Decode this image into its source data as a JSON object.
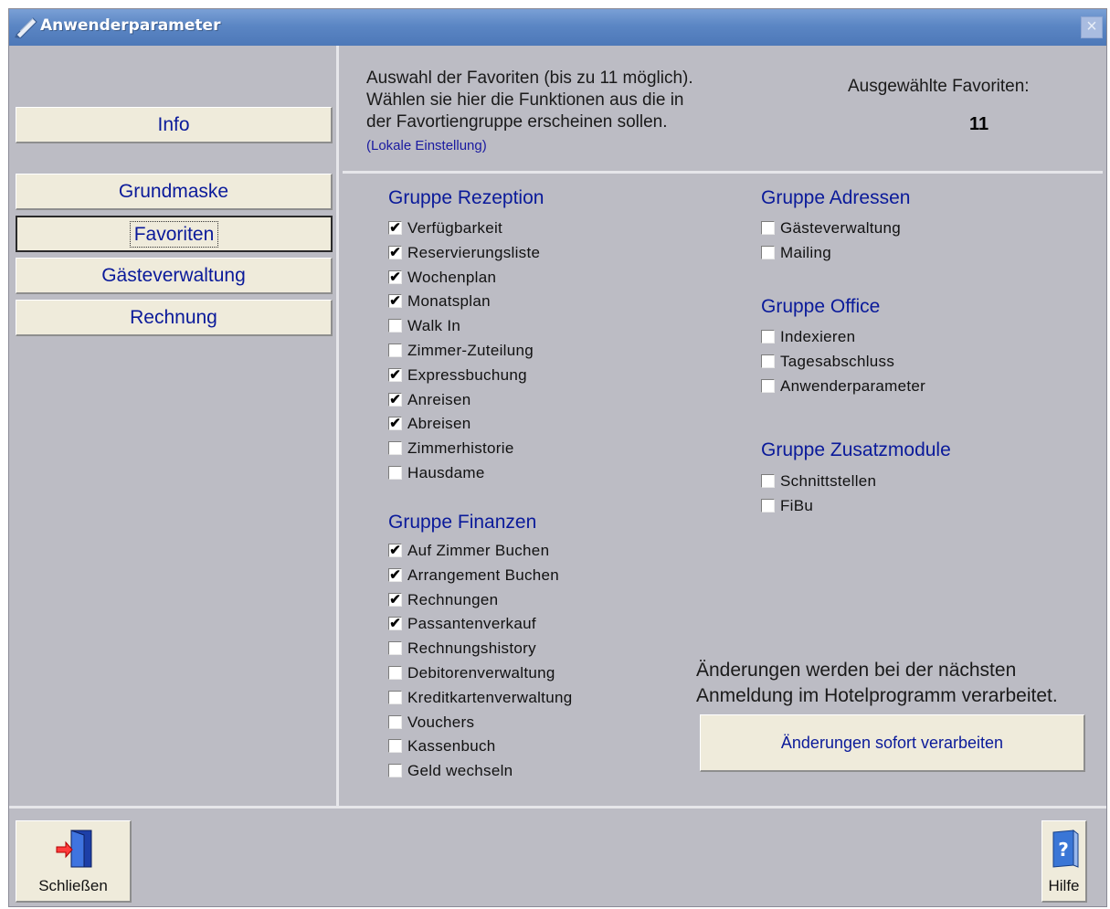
{
  "window": {
    "title": "Anwenderparameter",
    "close_glyph": "×"
  },
  "sidebar": {
    "items": [
      {
        "label": "Info"
      },
      {
        "label": "Grundmaske"
      },
      {
        "label": "Favoriten",
        "active": true
      },
      {
        "label": "Gästeverwaltung"
      },
      {
        "label": "Rechnung"
      }
    ]
  },
  "header": {
    "line1": "Auswahl der Favoriten (bis zu 11 möglich).",
    "line2": "Wählen sie hier die Funktionen aus die in",
    "line3": "der Favortiengruppe erscheinen sollen.",
    "local_note": "(Lokale Einstellung)",
    "selected_label": "Ausgewählte Favoriten:",
    "selected_count": "11"
  },
  "groups": {
    "rezeption": {
      "title": "Gruppe Rezeption",
      "items": [
        {
          "label": "Verfügbarkeit",
          "checked": true
        },
        {
          "label": "Reservierungsliste",
          "checked": true
        },
        {
          "label": "Wochenplan",
          "checked": true
        },
        {
          "label": "Monatsplan",
          "checked": true
        },
        {
          "label": "Walk In",
          "checked": false
        },
        {
          "label": "Zimmer-Zuteilung",
          "checked": false
        },
        {
          "label": "Expressbuchung",
          "checked": true
        },
        {
          "label": "Anreisen",
          "checked": true
        },
        {
          "label": "Abreisen",
          "checked": true
        },
        {
          "label": "Zimmerhistorie",
          "checked": false
        },
        {
          "label": "Hausdame",
          "checked": false
        }
      ]
    },
    "finanzen": {
      "title": "Gruppe Finanzen",
      "items": [
        {
          "label": "Auf Zimmer Buchen",
          "checked": true
        },
        {
          "label": "Arrangement Buchen",
          "checked": true
        },
        {
          "label": "Rechnungen",
          "checked": true
        },
        {
          "label": "Passantenverkauf",
          "checked": true
        },
        {
          "label": "Rechnungshistory",
          "checked": false
        },
        {
          "label": "Debitorenverwaltung",
          "checked": false
        },
        {
          "label": "Kreditkartenverwaltung",
          "checked": false
        },
        {
          "label": "Vouchers",
          "checked": false
        },
        {
          "label": "Kassenbuch",
          "checked": false
        },
        {
          "label": "Geld wechseln",
          "checked": false
        }
      ]
    },
    "adressen": {
      "title": "Gruppe Adressen",
      "items": [
        {
          "label": "Gästeverwaltung",
          "checked": false
        },
        {
          "label": "Mailing",
          "checked": false
        }
      ]
    },
    "office": {
      "title": "Gruppe Office",
      "items": [
        {
          "label": "Indexieren",
          "checked": false
        },
        {
          "label": "Tagesabschluss",
          "checked": false
        },
        {
          "label": "Anwenderparameter",
          "checked": false
        }
      ]
    },
    "zusatz": {
      "title": "Gruppe Zusatzmodule",
      "items": [
        {
          "label": "Schnittstellen",
          "checked": false
        },
        {
          "label": "FiBu",
          "checked": false
        }
      ]
    }
  },
  "note": {
    "line1": "Änderungen werden bei der nächsten",
    "line2": "Anmeldung im Hotelprogramm verarbeitet."
  },
  "apply_button": {
    "label": "Änderungen sofort verarbeiten"
  },
  "footer": {
    "close_label": "Schließen",
    "help_label": "Hilfe",
    "check_glyph": "✔",
    "help_glyph": "?"
  }
}
